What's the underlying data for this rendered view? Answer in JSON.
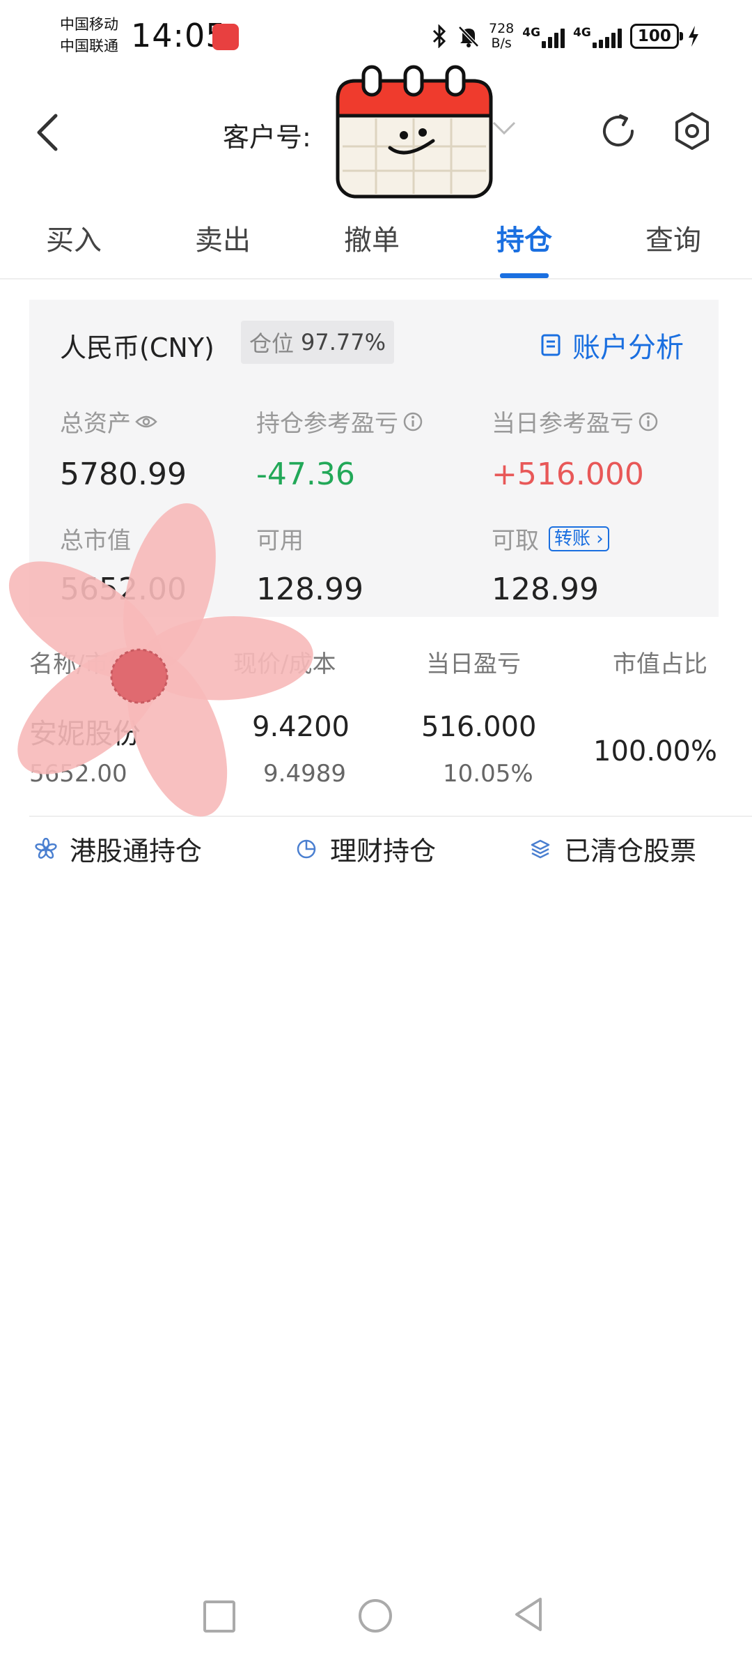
{
  "status_bar": {
    "carrier1": "中国移动",
    "carrier2": "中国联通",
    "time": "14:05",
    "speed_top": "728",
    "speed_bottom": "B/s",
    "net1": "4G",
    "net2": "4G",
    "battery": "100"
  },
  "header": {
    "customer_label": "客户号:",
    "back_icon": "chevron-left-icon",
    "refresh_icon": "refresh-icon",
    "settings_icon": "settings-hex-icon"
  },
  "tabs": [
    {
      "label": "买入",
      "active": false
    },
    {
      "label": "卖出",
      "active": false
    },
    {
      "label": "撤单",
      "active": false
    },
    {
      "label": "持仓",
      "active": true
    },
    {
      "label": "查询",
      "active": false
    }
  ],
  "summary": {
    "currency": "人民币(CNY)",
    "position_label": "仓位",
    "position_value": "97.77%",
    "analysis_label": "账户分析",
    "total_assets_label": "总资产",
    "total_assets_value": "5780.99",
    "holding_pl_label": "持仓参考盈亏",
    "holding_pl_value": "-47.36",
    "daily_pl_label": "当日参考盈亏",
    "daily_pl_value": "+516.000",
    "market_value_label": "总市值",
    "market_value_value": "5652.00",
    "available_label": "可用",
    "available_value": "128.99",
    "withdrawable_label": "可取",
    "withdrawable_value": "128.99",
    "transfer_label": "转账"
  },
  "table": {
    "headers": [
      "名称/市值",
      "现价/成本",
      "当日盈亏",
      "市值占比"
    ],
    "rows": [
      {
        "name": "安妮股份",
        "market_value": "5652.00",
        "price": "9.4200",
        "cost": "9.4989",
        "daily_pl": "516.000",
        "daily_pl_pct": "10.05%",
        "ratio": "100.00%"
      }
    ]
  },
  "links": {
    "hk_holdings": "港股通持仓",
    "wealth_holdings": "理财持仓",
    "cleared_stocks": "已清仓股票"
  },
  "colors": {
    "accent": "#1a6fe0",
    "gain": "#e85858",
    "loss": "#22a858"
  }
}
